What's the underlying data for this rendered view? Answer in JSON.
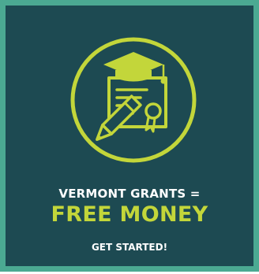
{
  "banner": {
    "headline": "VERMONT GRANTS =",
    "highlight": "FREE MONEY",
    "cta_label": "GET STARTED!"
  },
  "icons": {
    "emblem": "graduation-certificate-icon"
  },
  "colors": {
    "background": "#1d4a52",
    "border": "#4ba992",
    "accent": "#c3d63a",
    "text": "#ffffff"
  }
}
